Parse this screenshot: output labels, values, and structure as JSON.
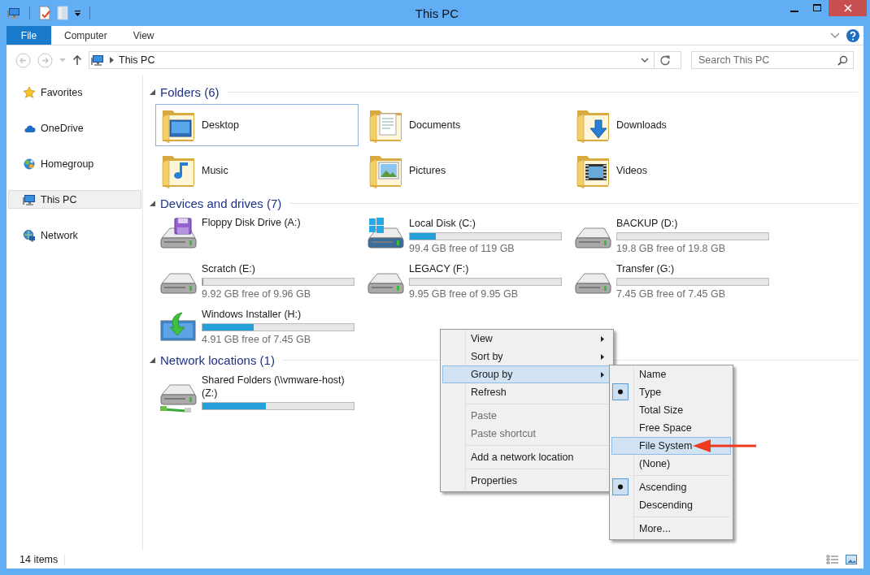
{
  "window": {
    "title": "This PC"
  },
  "ribbon": {
    "tabs": [
      {
        "label": "File",
        "kind": "application",
        "selected": false
      },
      {
        "label": "Computer",
        "kind": "tab",
        "selected": false
      },
      {
        "label": "View",
        "kind": "tab",
        "selected": false
      }
    ]
  },
  "address_bar": {
    "location": "This PC"
  },
  "search": {
    "placeholder": "Search This PC"
  },
  "sidebar": {
    "items": [
      {
        "label": "Favorites",
        "kind": "star",
        "selected": false
      },
      {
        "label": "OneDrive",
        "kind": "cloud",
        "selected": false
      },
      {
        "label": "Homegroup",
        "kind": "homegroup",
        "selected": false
      },
      {
        "label": "This PC",
        "kind": "pc",
        "selected": true
      },
      {
        "label": "Network",
        "kind": "network",
        "selected": false
      }
    ]
  },
  "groups": [
    {
      "title": "Folders (6)",
      "kind": "folders",
      "expanded": true,
      "items": [
        {
          "name": "Desktop",
          "kind": "desktop",
          "selected": true
        },
        {
          "name": "Documents",
          "kind": "documents",
          "selected": false
        },
        {
          "name": "Downloads",
          "kind": "downloads",
          "selected": false
        },
        {
          "name": "Music",
          "kind": "music",
          "selected": false
        },
        {
          "name": "Pictures",
          "kind": "pictures",
          "selected": false
        },
        {
          "name": "Videos",
          "kind": "videos",
          "selected": false
        }
      ]
    },
    {
      "title": "Devices and drives (7)",
      "kind": "drives",
      "expanded": true,
      "items": [
        {
          "name": "Floppy Disk Drive (A:)",
          "kind": "floppy"
        },
        {
          "name": "Local Disk (C:)",
          "kind": "system",
          "level": 0.17,
          "reading": "99.4 GB free of 119 GB"
        },
        {
          "name": "BACKUP (D:)",
          "kind": "disk",
          "level": 0,
          "reading": "19.8 GB free of 19.8 GB"
        },
        {
          "name": "Scratch (E:)",
          "kind": "disk",
          "level": 0.004,
          "reading": "9.92 GB free of 9.96 GB"
        },
        {
          "name": "LEGACY (F:)",
          "kind": "disk",
          "level": 0,
          "reading": "9.95 GB free of 9.95 GB"
        },
        {
          "name": "Transfer (G:)",
          "kind": "disk",
          "level": 0,
          "reading": "7.45 GB free of 7.45 GB"
        },
        {
          "name": "Windows Installer (H:)",
          "kind": "installer",
          "level": 0.34,
          "reading": "4.91 GB free of 7.45 GB"
        }
      ]
    },
    {
      "title": "Network locations (1)",
      "kind": "drives",
      "expanded": true,
      "items": [
        {
          "name": "Shared Folders (\\\\vmware-host) (Z:)",
          "kind": "network",
          "level": 0.42
        }
      ]
    }
  ],
  "context_menu": {
    "sections": [
      {
        "items": [
          {
            "label": "View",
            "submenu": true,
            "disabled": false,
            "selected": false
          },
          {
            "label": "Sort by",
            "submenu": true,
            "disabled": false,
            "selected": false
          },
          {
            "label": "Group by",
            "submenu": true,
            "disabled": false,
            "selected": true
          },
          {
            "label": "Refresh",
            "submenu": false,
            "disabled": false,
            "selected": false
          }
        ]
      },
      {
        "items": [
          {
            "label": "Paste",
            "submenu": false,
            "disabled": true,
            "selected": false
          },
          {
            "label": "Paste shortcut",
            "submenu": false,
            "disabled": true,
            "selected": false
          }
        ]
      },
      {
        "items": [
          {
            "label": "Add a network location",
            "submenu": false,
            "disabled": false,
            "selected": false
          }
        ]
      },
      {
        "items": [
          {
            "label": "Properties",
            "submenu": false,
            "disabled": false,
            "selected": false
          }
        ]
      }
    ]
  },
  "group_by_menu": {
    "sections": [
      {
        "items": [
          {
            "label": "Name",
            "checked": false,
            "selected": false
          },
          {
            "label": "Type",
            "checked": true,
            "selected": false
          },
          {
            "label": "Total Size",
            "checked": false,
            "selected": false
          },
          {
            "label": "Free Space",
            "checked": false,
            "selected": false
          },
          {
            "label": "File System",
            "checked": false,
            "selected": true
          },
          {
            "label": "(None)",
            "checked": false,
            "selected": false
          }
        ]
      },
      {
        "items": [
          {
            "label": "Ascending",
            "checked": true,
            "selected": false
          },
          {
            "label": "Descending",
            "checked": false,
            "selected": false
          }
        ]
      },
      {
        "items": [
          {
            "label": "More...",
            "checked": false,
            "selected": false
          }
        ]
      }
    ]
  },
  "status_bar": {
    "item_count": "14 items"
  }
}
